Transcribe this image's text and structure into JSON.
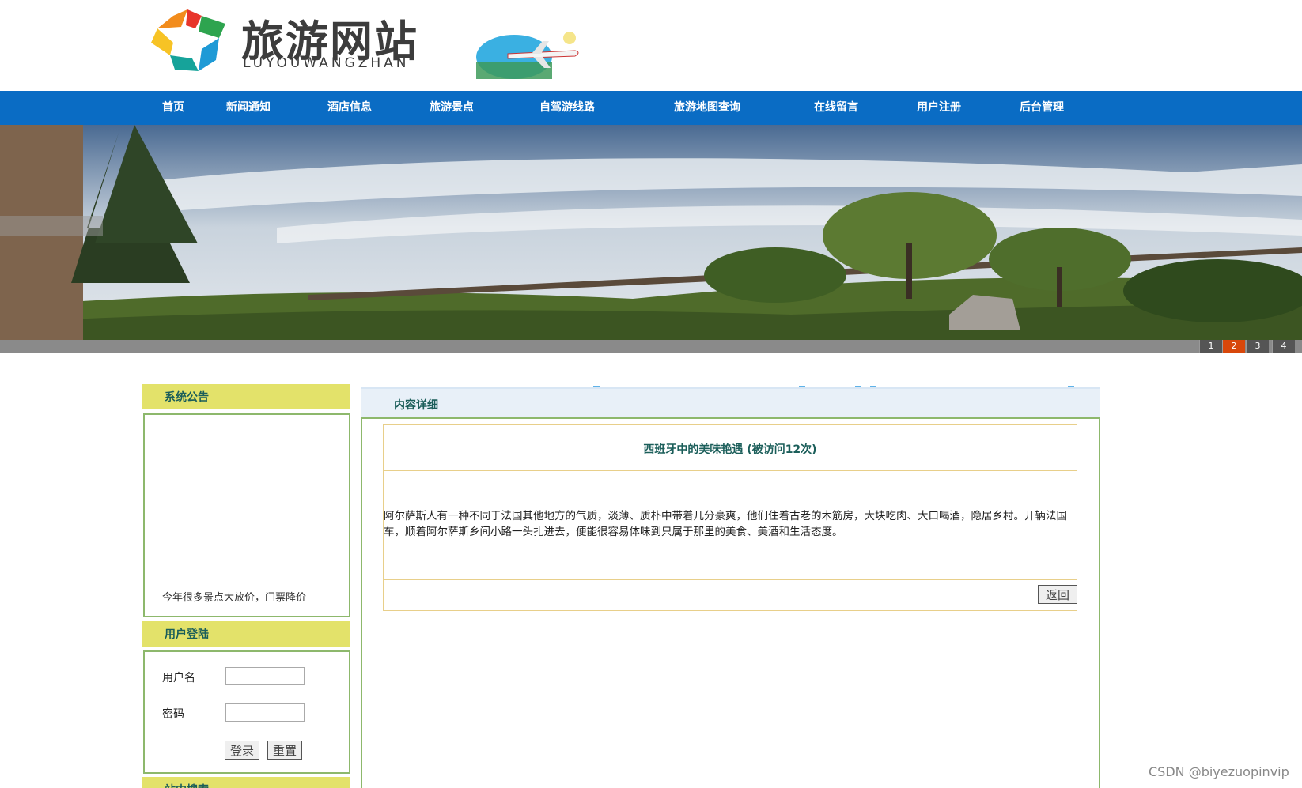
{
  "header": {
    "site_title": "旅游网站",
    "site_subtitle": "LUYOUWANGZHAN"
  },
  "nav": {
    "items": [
      {
        "label": "首页"
      },
      {
        "label": "新闻通知"
      },
      {
        "label": "酒店信息"
      },
      {
        "label": "旅游景点"
      },
      {
        "label": "自驾游线路"
      },
      {
        "label": "旅游地图查询"
      },
      {
        "label": "在线留言"
      },
      {
        "label": "用户注册"
      },
      {
        "label": "后台管理"
      }
    ]
  },
  "slider": {
    "pages": [
      "1",
      "2",
      "3",
      "4"
    ],
    "active": "2"
  },
  "sidebar": {
    "notice": {
      "heading": "系统公告",
      "marquee_text": "今年很多景点大放价，门票降价"
    },
    "login": {
      "heading": "用户登陆",
      "username_label": "用户名",
      "username_value": "",
      "password_label": "密码",
      "password_value": "",
      "login_button": "登录",
      "reset_button": "重置"
    },
    "search": {
      "heading": "站内搜索"
    }
  },
  "main": {
    "section_title": "内容详细",
    "article": {
      "title": "西班牙中的美味艳遇 (被访问12次)",
      "body": "阿尔萨斯人有一种不同于法国其他地方的气质，淡薄、质朴中带着几分豪爽，他们住着古老的木筋房，大块吃肉、大口喝酒，隐居乡村。开辆法国车，顺着阿尔萨斯乡间小路一头扎进去，便能很容易体味到只属于那里的美食、美酒和生活态度。",
      "back_button": "返回"
    }
  },
  "watermark": "CSDN @biyezuopinvip",
  "colors": {
    "nav_bg": "#0a6cc4",
    "side_head_bg": "#e3e26a",
    "side_border": "#8db86c",
    "heading_text": "#1b5e5a",
    "slider_active": "#d8470b"
  }
}
